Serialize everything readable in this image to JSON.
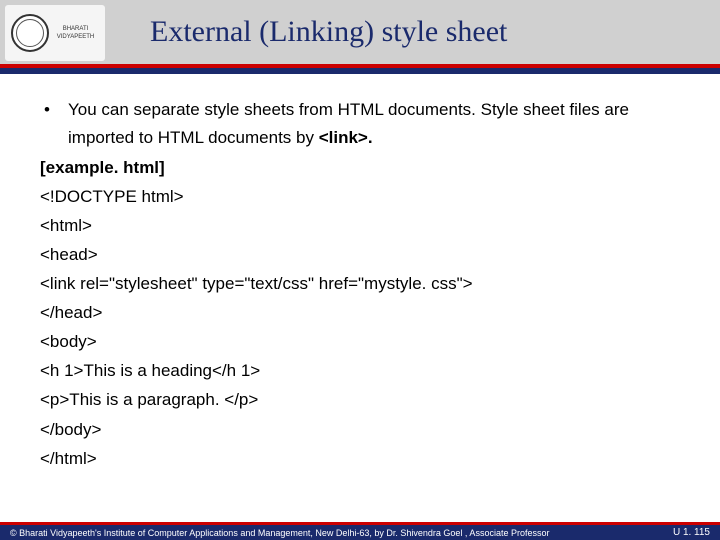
{
  "header": {
    "title": "External (Linking) style sheet",
    "logo_text": "BHARATI VIDYAPEETH"
  },
  "content": {
    "bullet_intro_1": "You can separate style sheets from HTML documents. Style sheet files are imported to HTML documents by ",
    "bullet_intro_link": "<link>.",
    "example_label": "[example. html]",
    "lines": [
      "<!DOCTYPE html>",
      "<html>",
      "<head>",
      "<link rel=\"stylesheet\" type=\"text/css\" href=\"mystyle. css\">",
      "</head>",
      "<body>",
      "<h 1>This is a heading</h 1>",
      "<p>This is a paragraph. </p>",
      "</body>",
      "</html>"
    ]
  },
  "footer": {
    "copyright": "© Bharati Vidyapeeth's Institute of Computer Applications and Management, New Delhi-63, by Dr. Shivendra Goel , Associate Professor",
    "page": "U 1. 115"
  }
}
